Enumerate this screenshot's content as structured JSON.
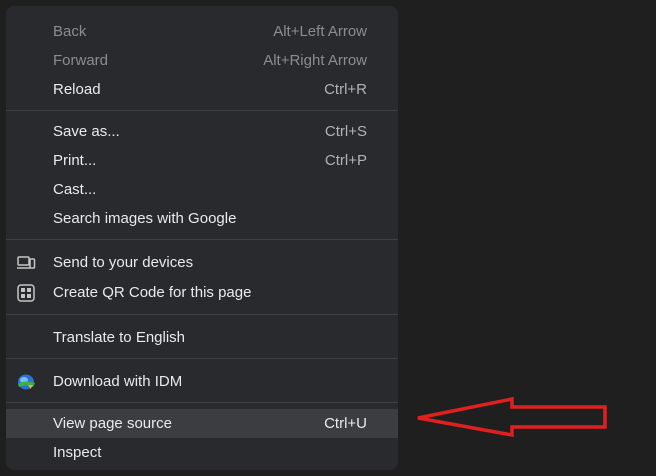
{
  "menu": {
    "back": {
      "label": "Back",
      "shortcut": "Alt+Left Arrow"
    },
    "forward": {
      "label": "Forward",
      "shortcut": "Alt+Right Arrow"
    },
    "reload": {
      "label": "Reload",
      "shortcut": "Ctrl+R"
    },
    "save_as": {
      "label": "Save as...",
      "shortcut": "Ctrl+S"
    },
    "print": {
      "label": "Print...",
      "shortcut": "Ctrl+P"
    },
    "cast": {
      "label": "Cast..."
    },
    "search_images": {
      "label": "Search images with Google"
    },
    "send_devices": {
      "label": "Send to your devices",
      "icon": "devices-icon"
    },
    "qr_code": {
      "label": "Create QR Code for this page",
      "icon": "qr-code-icon"
    },
    "translate": {
      "label": "Translate to English"
    },
    "idm": {
      "label": "Download with IDM",
      "icon": "idm-icon"
    },
    "view_source": {
      "label": "View page source",
      "shortcut": "Ctrl+U"
    },
    "inspect": {
      "label": "Inspect"
    }
  },
  "annotation": {
    "type": "arrow",
    "color": "#e0201f",
    "points_to": "view_source"
  }
}
